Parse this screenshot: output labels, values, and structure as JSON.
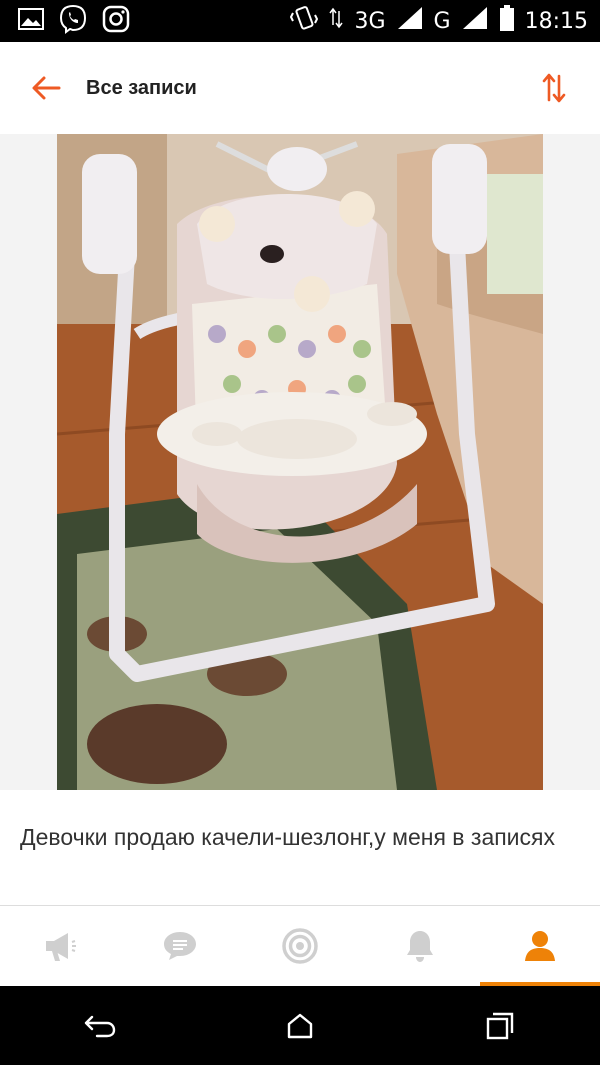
{
  "status_bar": {
    "time": "18:15",
    "network_3g": "3G",
    "network_g": "G",
    "left_icons": [
      "gallery-icon",
      "viber-icon",
      "instagram-icon"
    ],
    "right_icons": [
      "vibrate-icon",
      "data-transfer-icon",
      "signal-icon",
      "signal-icon",
      "battery-icon"
    ]
  },
  "header": {
    "title": "Все записи",
    "back_icon": "arrow-left-icon",
    "sort_icon": "sort-arrows-icon",
    "accent_color": "#ee5a24"
  },
  "post": {
    "text": "Девочки продаю качели-шезлонг,у меня в записях"
  },
  "bottom_nav": {
    "items": [
      {
        "icon": "megaphone-icon",
        "active": false
      },
      {
        "icon": "chat-icon",
        "active": false
      },
      {
        "icon": "target-icon",
        "active": false
      },
      {
        "icon": "bell-icon",
        "active": false
      },
      {
        "icon": "profile-icon",
        "active": true
      }
    ],
    "active_color": "#ee8208",
    "inactive_color": "#cfcfcf"
  },
  "system_nav": {
    "icons": [
      "back-icon",
      "home-icon",
      "recent-apps-icon"
    ]
  }
}
